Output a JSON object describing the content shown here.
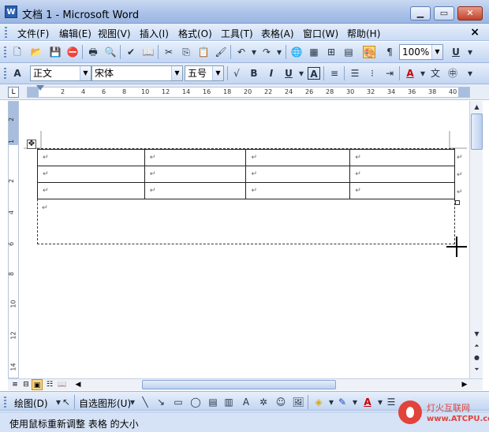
{
  "window": {
    "title": "文档 1 - Microsoft Word",
    "app_icon": "W"
  },
  "menubar": {
    "items": [
      "文件(F)",
      "编辑(E)",
      "视图(V)",
      "插入(I)",
      "格式(O)",
      "工具(T)",
      "表格(A)",
      "窗口(W)",
      "帮助(H)"
    ],
    "close": "×"
  },
  "standard_toolbar": {
    "zoom": "100%"
  },
  "formatting_toolbar": {
    "style": "正文",
    "font": "宋体",
    "size": "五号",
    "bold": "B",
    "italic": "I",
    "underline": "U",
    "char_border": "A"
  },
  "ruler": {
    "ticks": [
      "2",
      "4",
      "6",
      "8",
      "10",
      "12",
      "14",
      "16",
      "18",
      "20",
      "22",
      "24",
      "26",
      "28",
      "30",
      "32",
      "34",
      "36",
      "38",
      "40"
    ],
    "corner": "L"
  },
  "vruler": {
    "ticks": [
      "2",
      "1",
      "2",
      "4",
      "6",
      "8",
      "10",
      "12",
      "14"
    ]
  },
  "table": {
    "rows": 3,
    "cols": 4,
    "cell_mark": "↵"
  },
  "drawing_toolbar": {
    "draw_label": "绘图(D)",
    "autoshapes_label": "自选图形(U)"
  },
  "status": {
    "text": "使用鼠标重新调整 表格 的大小"
  },
  "watermark": {
    "line1": "灯火互联网",
    "line2": "www.ATCPU.com"
  },
  "colors": {
    "titlebar": "#a9c1e8",
    "toolbar": "#c3d6f2",
    "accent": "#2b5fb5"
  }
}
